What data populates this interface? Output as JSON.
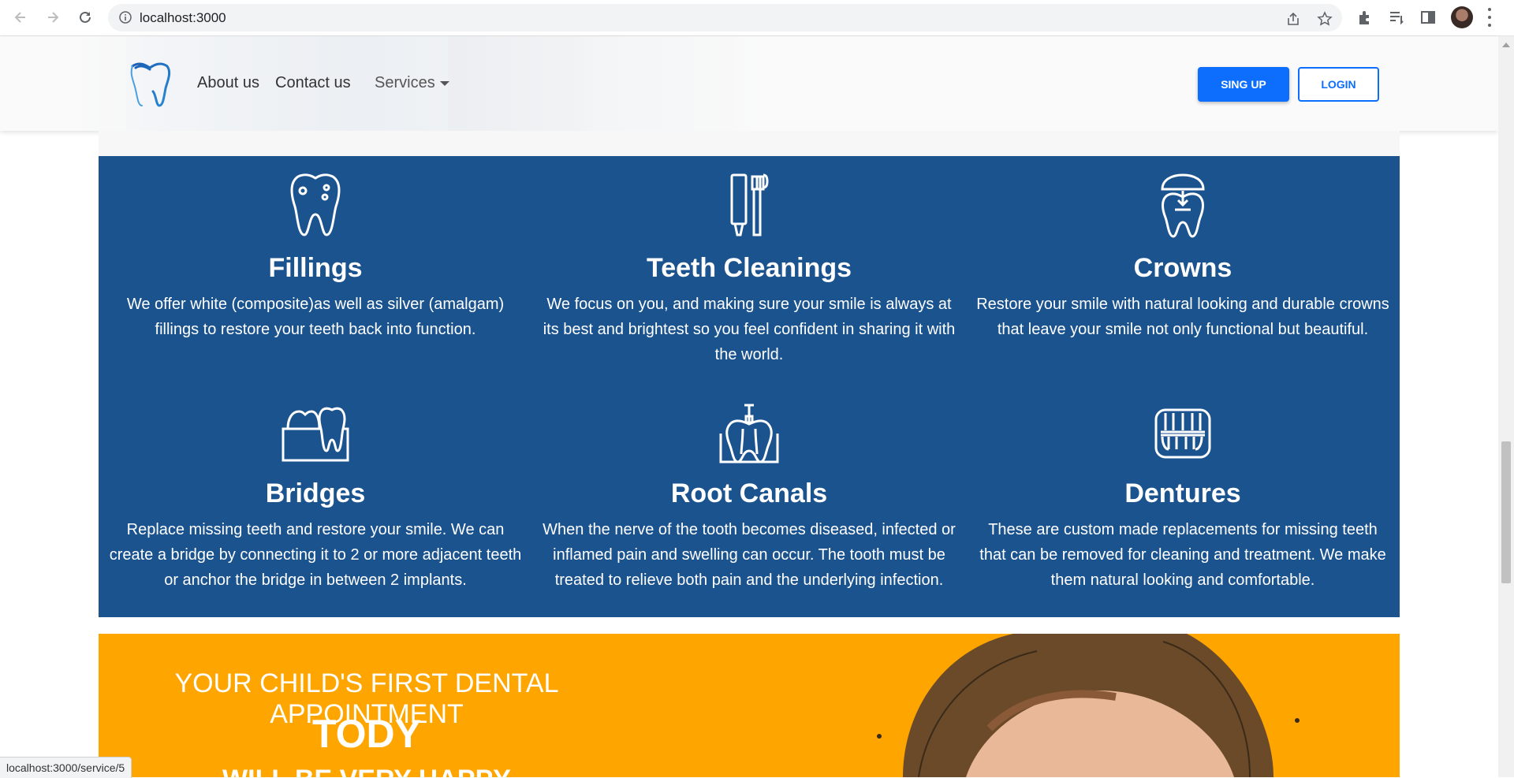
{
  "browser": {
    "url": "localhost:3000",
    "status_url": "localhost:3000/service/5"
  },
  "header": {
    "menu": {
      "about": "About us",
      "contact": "Contact us",
      "services": "Services"
    },
    "signup_label": "SING UP",
    "login_label": "LOGIN"
  },
  "colors": {
    "panel": "#1b538f",
    "promo": "#ffa500",
    "primary": "#0d6efd"
  },
  "services": [
    {
      "icon": "tooth-filling-icon",
      "title": "Fillings",
      "text": "We offer white (composite)as well as silver (amalgam) fillings to restore your teeth back into function."
    },
    {
      "icon": "toothbrush-icon",
      "title": "Teeth Cleanings",
      "text": "We focus on you, and making sure your smile is always at its best and brightest so you feel confident in sharing it with the world."
    },
    {
      "icon": "crown-icon",
      "title": "Crowns",
      "text": "Restore your smile with natural looking and durable crowns that leave your smile not only functional but beautiful."
    },
    {
      "icon": "bridge-icon",
      "title": "Bridges",
      "text": "Replace missing teeth and restore your smile. We can create a bridge by connecting it to 2 or more adjacent teeth or anchor the bridge in between 2 implants."
    },
    {
      "icon": "root-canal-icon",
      "title": "Root Canals",
      "text": "When the nerve of the tooth becomes diseased, infected or inflamed pain and swelling can occur. The tooth must be treated to relieve both pain and the underlying infection."
    },
    {
      "icon": "dentures-icon",
      "title": "Dentures",
      "text": "These are custom made replacements for missing teeth that can be removed for cleaning and treatment. We make them natural looking and comfortable."
    }
  ],
  "promo": {
    "line1": "YOUR CHILD'S FIRST DENTAL APPOINTMENT",
    "line2": "TODY",
    "line3": "WILL BE VERY HAPPY"
  }
}
